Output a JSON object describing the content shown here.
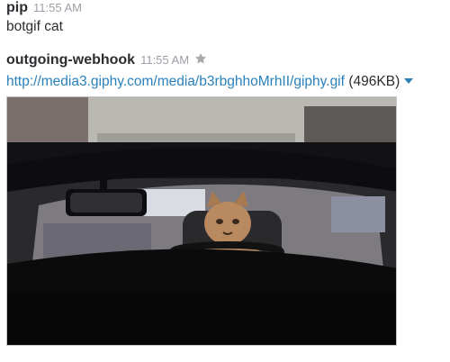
{
  "messages": [
    {
      "sender": "pip",
      "time": "11:55 AM",
      "text": "botgif cat"
    },
    {
      "sender": "outgoing-webhook",
      "time": "11:55 AM",
      "link": "http://media3.giphy.com/media/b3rbghhoMrhII/giphy.gif",
      "size": "(496KB)",
      "icons": {
        "star": "star-icon",
        "caret": "caret-down-icon"
      }
    }
  ],
  "colors": {
    "link": "#2a80b9",
    "timestamp": "#9e9ea6",
    "text": "#2c2d30"
  }
}
